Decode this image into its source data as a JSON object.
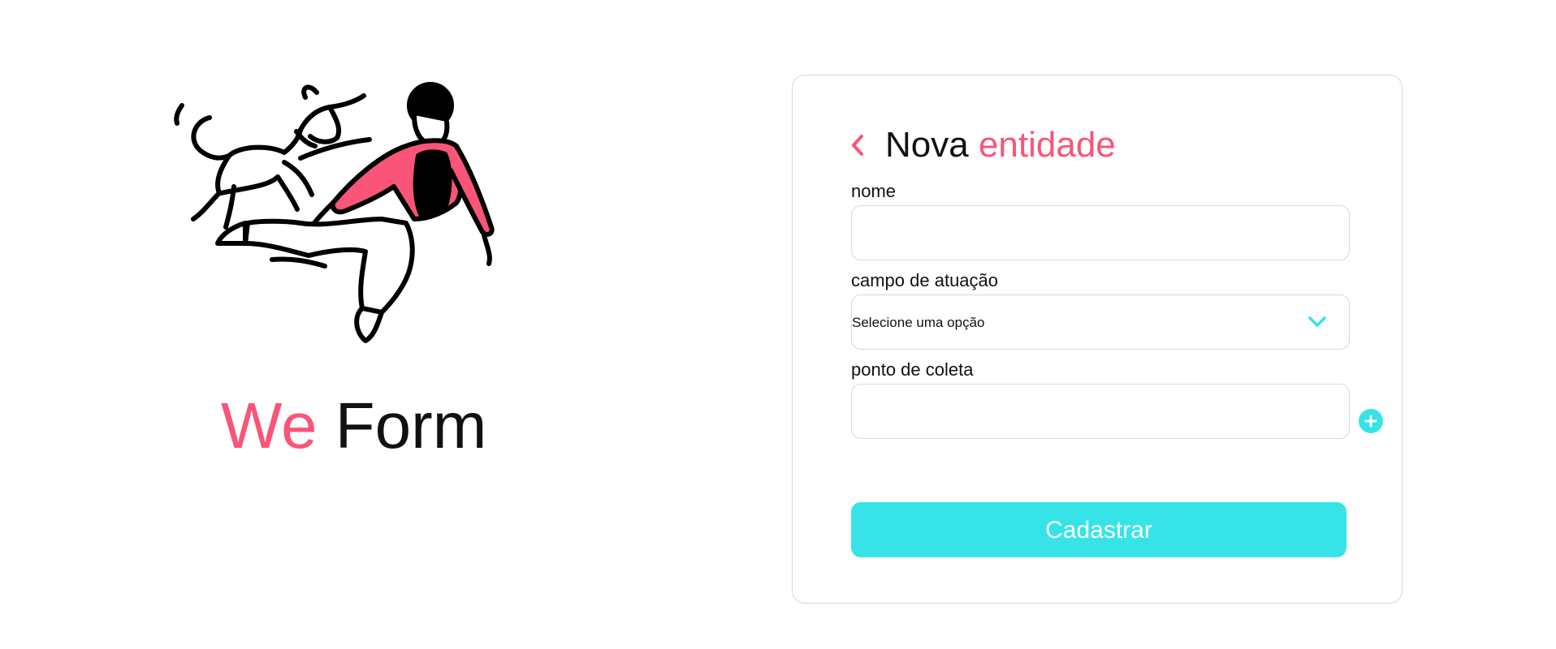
{
  "brand": {
    "accent": "We",
    "rest": "Form"
  },
  "form": {
    "title_part1": "Nova",
    "title_part2": "entidade",
    "fields": [
      {
        "label": "nome",
        "value": ""
      },
      {
        "label": "campo de atuação",
        "selected": "Selecione uma opção"
      },
      {
        "label": "ponto de coleta",
        "value": ""
      }
    ],
    "submit_label": "Cadastrar"
  },
  "icons": {
    "back": "chevron-left-icon",
    "dropdown": "chevron-down-icon",
    "add": "plus-icon"
  },
  "colors": {
    "accent_pink": "#fa5478",
    "accent_cyan": "#36e4e8",
    "text": "#111111",
    "border": "#d9d9d9"
  }
}
